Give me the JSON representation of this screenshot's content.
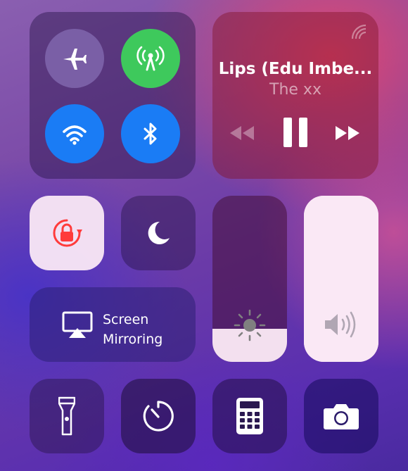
{
  "connectivity": {
    "airplane": {
      "icon": "airplane-icon",
      "state": "off",
      "color": "#7a5fa6"
    },
    "cellular": {
      "icon": "cellular-antenna-icon",
      "state": "on",
      "color": "#3ec95c"
    },
    "wifi": {
      "icon": "wifi-icon",
      "state": "on",
      "color": "#1a7cf5"
    },
    "bluetooth": {
      "icon": "bluetooth-icon",
      "state": "on",
      "color": "#1a7cf5"
    }
  },
  "now_playing": {
    "title": "Lips (Edu Imbe...",
    "artist": "The xx",
    "controls": [
      "rewind-icon",
      "pause-icon",
      "fast-forward-icon"
    ],
    "airplay_icon": "airplay-audio-icon"
  },
  "toggles": {
    "rotation_lock": {
      "icon": "rotation-lock-icon",
      "state": "on",
      "color": "#ff3b3b"
    },
    "do_not_disturb": {
      "icon": "moon-icon",
      "state": "off"
    }
  },
  "screen_mirroring": {
    "label_line1": "Screen",
    "label_line2": "Mirroring",
    "icon": "airplay-screen-icon"
  },
  "sliders": {
    "brightness": {
      "icon": "sun-icon",
      "level": 0.2
    },
    "volume": {
      "icon": "speaker-volume-icon",
      "level": 1.0
    }
  },
  "bottom_row": [
    "flashlight-icon",
    "timer-icon",
    "calculator-icon",
    "camera-icon"
  ]
}
